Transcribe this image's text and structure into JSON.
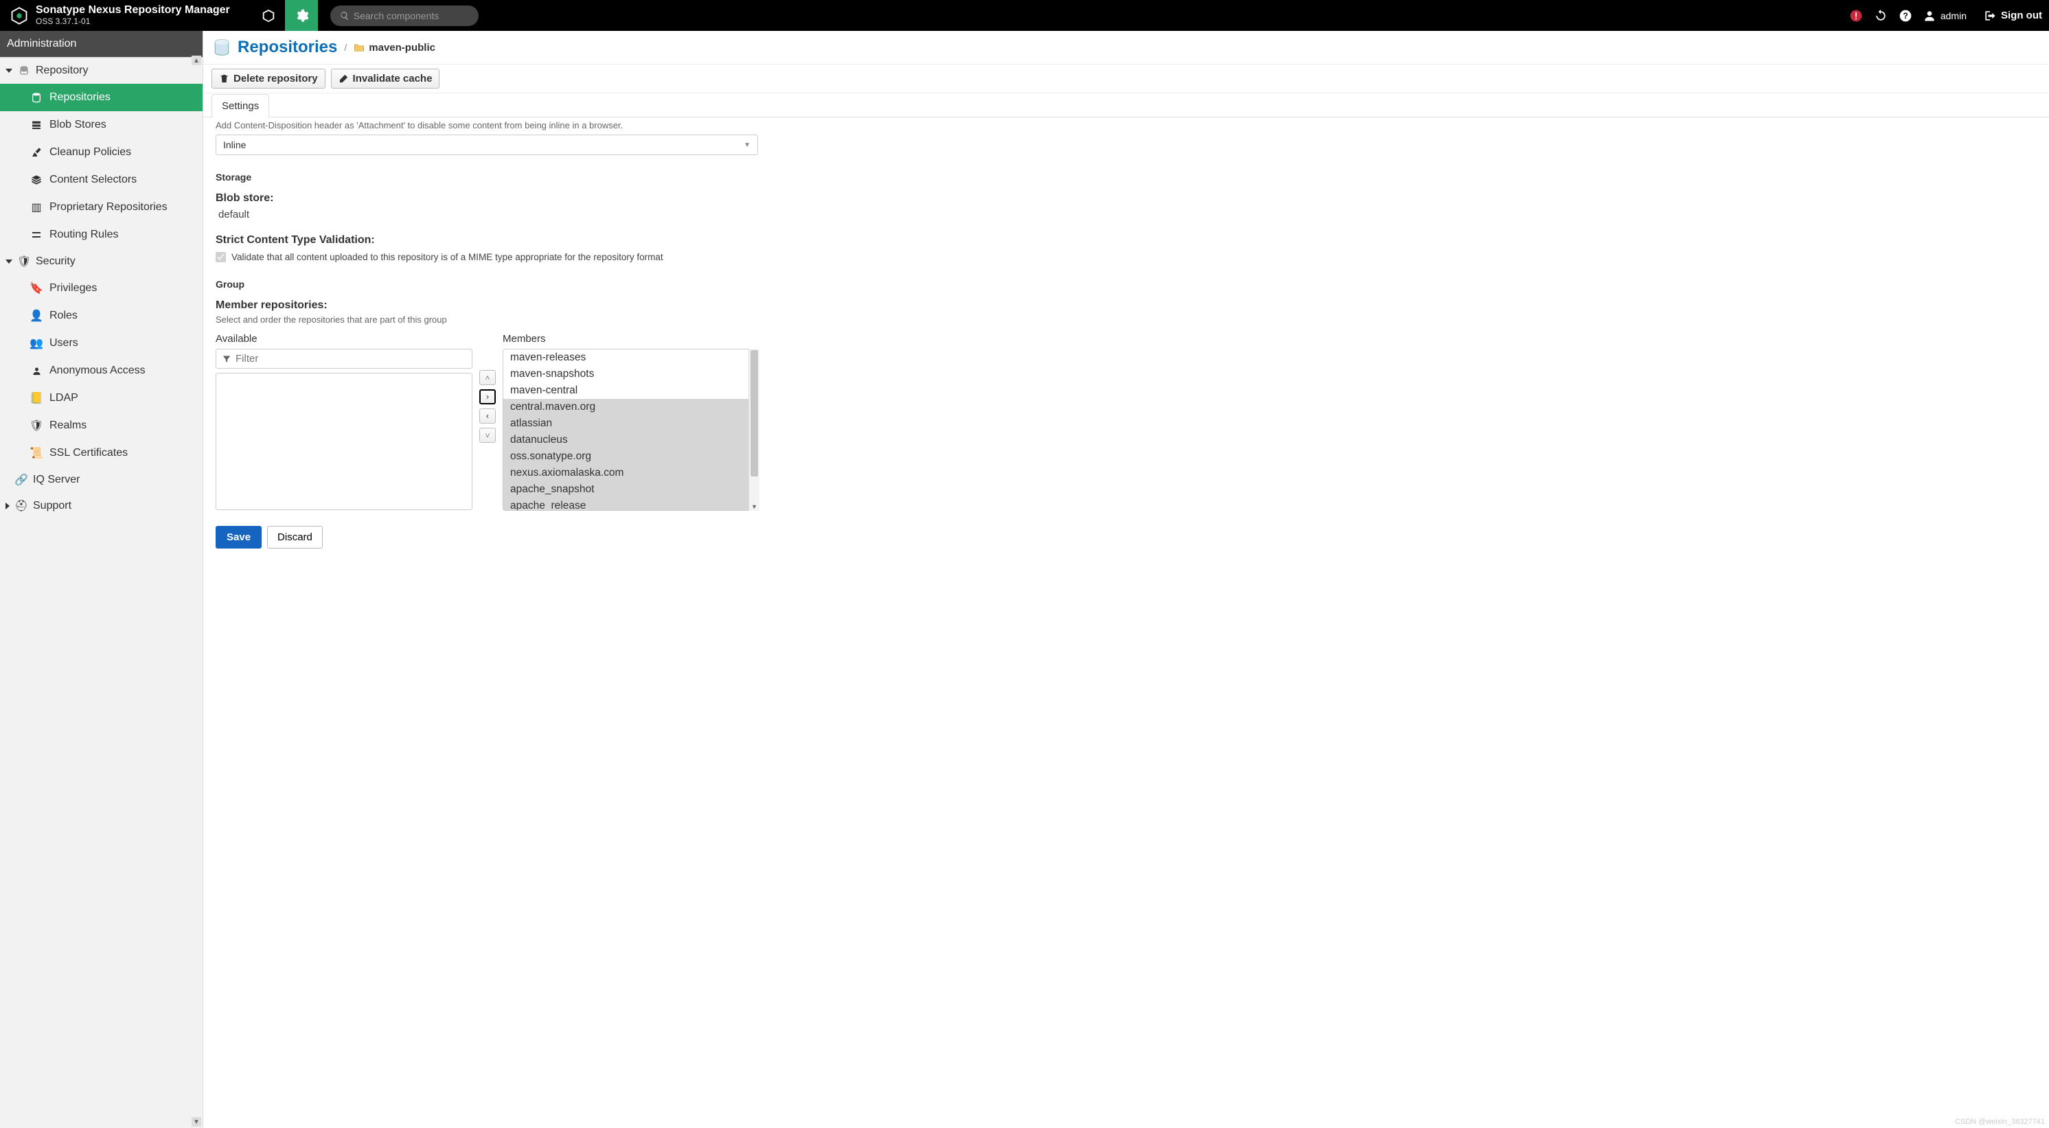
{
  "header": {
    "brand_title": "Sonatype Nexus Repository Manager",
    "brand_sub": "OSS 3.37.1-01",
    "search_placeholder": "Search components",
    "user_label": "admin",
    "signout_label": "Sign out"
  },
  "sidebar": {
    "title": "Administration",
    "groups": [
      {
        "label": "Repository",
        "expanded": true,
        "items": [
          {
            "label": "Repositories",
            "active": true
          },
          {
            "label": "Blob Stores"
          },
          {
            "label": "Cleanup Policies"
          },
          {
            "label": "Content Selectors"
          },
          {
            "label": "Proprietary Repositories"
          },
          {
            "label": "Routing Rules"
          }
        ]
      },
      {
        "label": "Security",
        "expanded": true,
        "items": [
          {
            "label": "Privileges"
          },
          {
            "label": "Roles"
          },
          {
            "label": "Users"
          },
          {
            "label": "Anonymous Access"
          },
          {
            "label": "LDAP"
          },
          {
            "label": "Realms"
          },
          {
            "label": "SSL Certificates"
          }
        ]
      },
      {
        "label": "IQ Server",
        "expanded": false,
        "leaf": true
      },
      {
        "label": "Support",
        "expanded": false
      }
    ]
  },
  "crumb": {
    "main": "Repositories",
    "sub": "maven-public"
  },
  "toolbar": {
    "delete": "Delete repository",
    "invalidate": "Invalidate cache"
  },
  "tabs": {
    "settings": "Settings"
  },
  "form": {
    "cd_help": "Add Content-Disposition header as 'Attachment' to disable some content from being inline in a browser.",
    "cd_value": "Inline",
    "storage_h": "Storage",
    "blob_label": "Blob store:",
    "blob_value": "default",
    "strict_label": "Strict Content Type Validation:",
    "strict_help": "Validate that all content uploaded to this repository is of a MIME type appropriate for the repository format",
    "group_h": "Group",
    "members_label": "Member repositories:",
    "members_help": "Select and order the repositories that are part of this group",
    "available_title": "Available",
    "filter_placeholder": "Filter",
    "members_title": "Members",
    "members_list": [
      "maven-releases",
      "maven-snapshots",
      "maven-central",
      "central.maven.org",
      "atlassian",
      "datanucleus",
      "oss.sonatype.org",
      "nexus.axiomalaska.com",
      "apache_snapshot",
      "apache_release"
    ],
    "save": "Save",
    "discard": "Discard"
  },
  "watermark": "CSDN @weixin_38327741"
}
